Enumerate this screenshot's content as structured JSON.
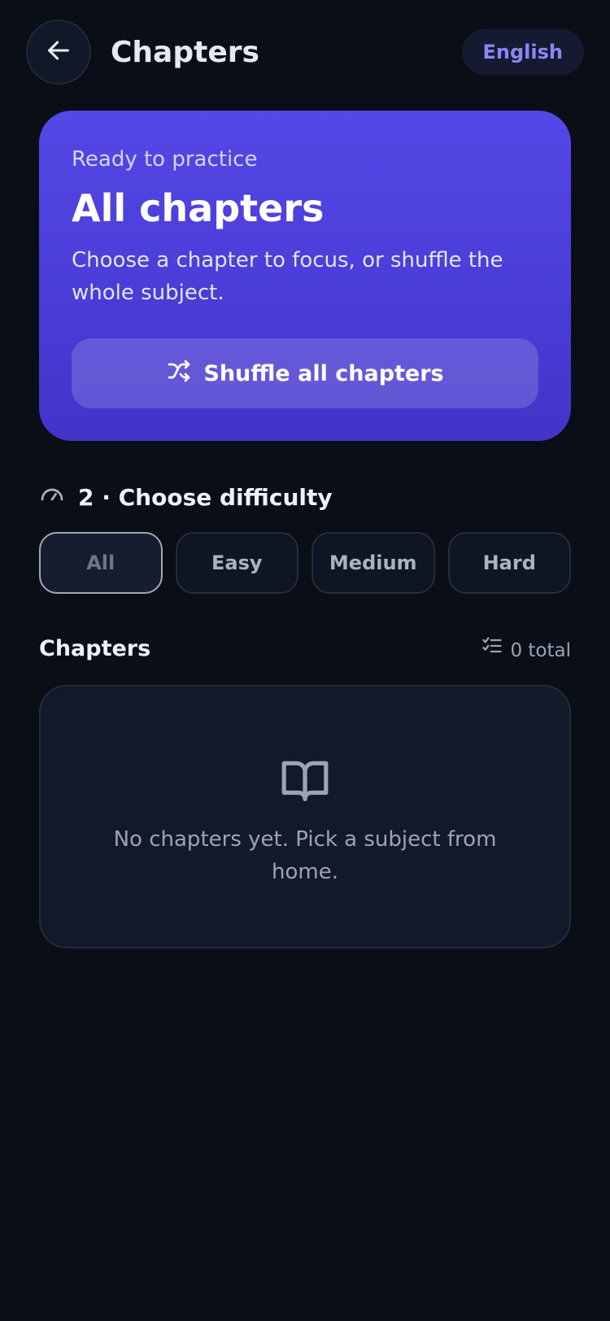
{
  "header": {
    "title": "Chapters",
    "language": "English",
    "back_icon": "arrow-left-icon"
  },
  "hero": {
    "eyebrow": "Ready to practice",
    "title": "All chapters",
    "description": "Choose a chapter to focus, or shuffle the whole subject.",
    "shuffle_label": "Shuffle all chapters",
    "shuffle_icon": "shuffle-icon"
  },
  "difficulty": {
    "heading": "2 · Choose difficulty",
    "icon": "gauge-icon",
    "options": [
      "All",
      "Easy",
      "Medium",
      "Hard"
    ],
    "selected": "All"
  },
  "chapters": {
    "title": "Chapters",
    "count_label": "0 total",
    "count_icon": "checklist-icon",
    "empty_icon": "book-open-icon",
    "empty_message": "No chapters yet. Pick a subject from home."
  },
  "colors": {
    "background": "#0a0e17",
    "hero_start": "#5448e6",
    "hero_end": "#4334c8",
    "accent_text": "#8b87f5"
  }
}
